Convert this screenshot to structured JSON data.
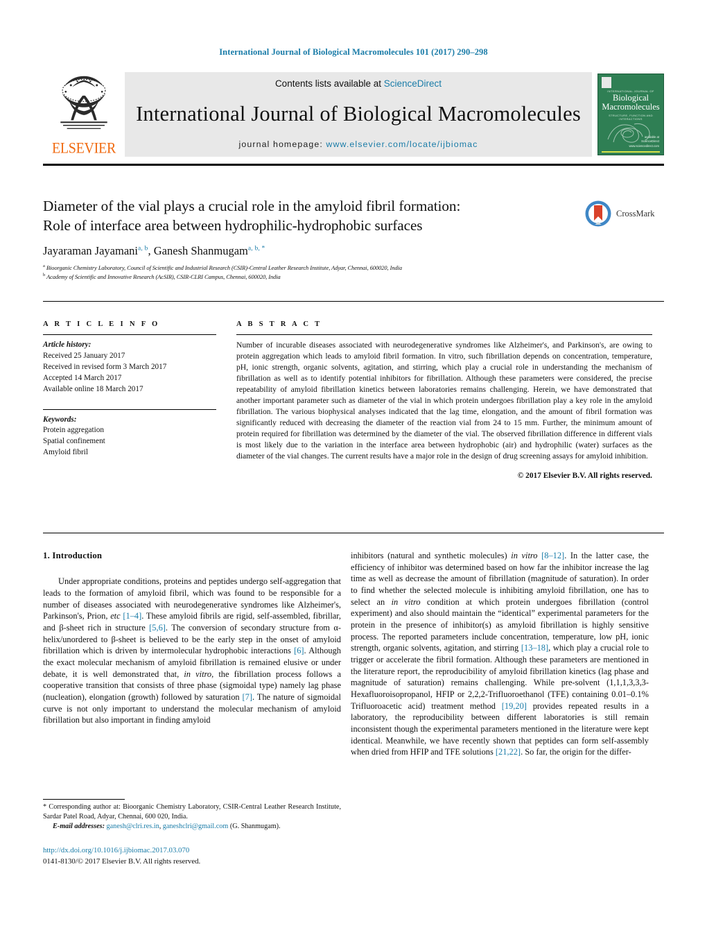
{
  "running_head": "International Journal of Biological Macromolecules 101 (2017) 290–298",
  "masthead": {
    "publisher": "ELSEVIER",
    "contents_prefix": "Contents lists available at ",
    "contents_link": "ScienceDirect",
    "journal_title": "International Journal of Biological Macromolecules",
    "homepage_prefix": "journal homepage: ",
    "homepage_url": "www.elsevier.com/locate/ijbiomac",
    "cover": {
      "kicker": "INTERNATIONAL JOURNAL OF",
      "title_line1": "Biological",
      "title_line2": "Macromolecules",
      "subtitle": "STRUCTURE, FUNCTION AND INTERACTIONS",
      "sd_line1": "available at",
      "sd_line2": "ScienceDirect",
      "sd_line3": "www.sciencedirect.com"
    }
  },
  "article": {
    "title_line1": "Diameter of the vial plays a crucial role in the amyloid fibril formation:",
    "title_line2": "Role of interface area between hydrophilic-hydrophobic surfaces",
    "crossmark_label": "CrossMark",
    "authors": [
      {
        "name": "Jayaraman Jayamani",
        "marks": "a, b"
      },
      {
        "name": "Ganesh Shanmugam",
        "marks": "a, b, *"
      }
    ],
    "authors_separator": ", ",
    "affiliations": [
      {
        "mark": "a",
        "text": "Bioorganic Chemistry Laboratory, Council of Scientific and Industrial Research (CSIR)-Central Leather Research Institute, Adyar, Chennai, 600020, India"
      },
      {
        "mark": "b",
        "text": "Academy of Scientific and Innovative Research (AcSIR), CSIR-CLRI Campus, Chennai, 600020, India"
      }
    ]
  },
  "article_info": {
    "heading": "A R T I C L E   I N F O",
    "history_label": "Article history:",
    "history": [
      "Received 25 January 2017",
      "Received in revised form 3 March 2017",
      "Accepted 14 March 2017",
      "Available online 18 March 2017"
    ],
    "keywords_label": "Keywords:",
    "keywords": [
      "Protein aggregation",
      "Spatial confinement",
      "Amyloid fibril"
    ]
  },
  "abstract": {
    "heading": "A B S T R A C T",
    "body": "Number of incurable diseases associated with neurodegenerative syndromes like Alzheimer's, and Parkinson's, are owing to protein aggregation which leads to amyloid fibril formation. In vitro, such fibrillation depends on concentration, temperature, pH, ionic strength, organic solvents, agitation, and stirring, which play a crucial role in understanding the mechanism of fibrillation as well as to identify potential inhibitors for fibrillation. Although these parameters were considered, the precise repeatability of amyloid fibrillation kinetics between laboratories remains challenging. Herein, we have demonstrated that another important parameter such as diameter of the vial in which protein undergoes fibrillation play a key role in the amyloid fibrillation. The various biophysical analyses indicated that the lag time, elongation, and the amount of fibril formation was significantly reduced with decreasing the diameter of the reaction vial from 24 to 15 mm. Further, the minimum amount of protein required for fibrillation was determined by the diameter of the vial. The observed fibrillation difference in different vials is most likely due to the variation in the interface area between hydrophobic (air) and hydrophilic (water) surfaces as the diameter of the vial changes. The current results have a major role in the design of drug screening assays for amyloid inhibition.",
    "copyright": "© 2017 Elsevier B.V. All rights reserved."
  },
  "introduction": {
    "heading": "1.  Introduction",
    "left_segments": [
      {
        "t": "Under appropriate conditions, proteins and peptides undergo self-aggregation that leads to the formation of amyloid fibril, which was found to be responsible for a number of diseases associated with neurodegenerative syndromes like Alzheimer's, Parkinson's, Prion, ",
        "k": "plain"
      },
      {
        "t": "etc",
        "k": "italic"
      },
      {
        "t": " ",
        "k": "plain"
      },
      {
        "t": "[1–4]",
        "k": "ref"
      },
      {
        "t": ". These amyloid fibrils are rigid, self-assembled, fibrillar, and β-sheet rich in structure ",
        "k": "plain"
      },
      {
        "t": "[5,6]",
        "k": "ref"
      },
      {
        "t": ". The conversion of secondary structure from α-helix/unordered to β-sheet is believed to be the early step in the onset of amyloid fibrillation which is driven by intermolecular hydrophobic interactions ",
        "k": "plain"
      },
      {
        "t": "[6]",
        "k": "ref"
      },
      {
        "t": ". Although the exact molecular mechanism of amyloid fibrillation is remained elusive or under debate, it is well demonstrated that, ",
        "k": "plain"
      },
      {
        "t": "in vitro",
        "k": "italic"
      },
      {
        "t": ", the fibrillation process follows a cooperative transition that consists of three phase (sigmoidal type) namely lag phase (nucleation), elongation (growth) followed by saturation ",
        "k": "plain"
      },
      {
        "t": "[7]",
        "k": "ref"
      },
      {
        "t": ". The nature of sigmoidal curve is not only important to understand the molecular mechanism of amyloid fibrillation but also important in finding amyloid",
        "k": "plain"
      }
    ],
    "right_segments": [
      {
        "t": "inhibitors (natural and synthetic molecules) ",
        "k": "plain"
      },
      {
        "t": "in vitro",
        "k": "italic"
      },
      {
        "t": " ",
        "k": "plain"
      },
      {
        "t": "[8–12]",
        "k": "ref"
      },
      {
        "t": ". In the latter case, the efficiency of inhibitor was determined based on how far the inhibitor increase the lag time as well as decrease the amount of fibrillation (magnitude of saturation). In order to find whether the selected molecule is inhibiting amyloid fibrillation, one has to select an ",
        "k": "plain"
      },
      {
        "t": "in vitro",
        "k": "italic"
      },
      {
        "t": " condition at which protein undergoes fibrillation (control experiment) and also should maintain the “identical” experimental parameters for the protein in the presence of inhibitor(s) as amyloid fibrillation is highly sensitive process. The reported parameters include concentration, temperature, low pH, ionic strength, organic solvents, agitation, and stirring ",
        "k": "plain"
      },
      {
        "t": "[13–18]",
        "k": "ref"
      },
      {
        "t": ", which play a crucial role to trigger or accelerate the fibril formation. Although these parameters are mentioned in the literature report, the reproducibility of amyloid fibrillation kinetics (lag phase and magnitude of saturation) remains challenging. While pre-solvent (1,1,1,3,3,3-Hexafluoroisopropanol, HFIP or 2,2,2-Trifluoroethanol (TFE) containing 0.01–0.1% Trifluoroacetic acid) treatment method ",
        "k": "plain"
      },
      {
        "t": "[19,20]",
        "k": "ref"
      },
      {
        "t": " provides repeated results in a laboratory, the reproducibility between different laboratories is still remain inconsistent though the experimental parameters mentioned in the literature were kept identical. Meanwhile, we have recently shown that peptides can form self-assembly when dried from HFIP and TFE solutions ",
        "k": "plain"
      },
      {
        "t": "[21,22]",
        "k": "ref"
      },
      {
        "t": ". So far, the origin for the differ-",
        "k": "plain"
      }
    ]
  },
  "footnote": {
    "marker": "*",
    "corresponding": " Corresponding author at: Bioorganic Chemistry Laboratory, CSIR-Central Leather Research Institute, Sardar Patel Road, Adyar, Chennai, 600 020, India.",
    "email_label": "E-mail addresses:",
    "email1": "ganesh@clri.res.in",
    "email_sep": ", ",
    "email2": "ganeshclri@gmail.com",
    "email_attrib": " (G. Shanmugam)."
  },
  "doi_block": {
    "doi": "http://dx.doi.org/10.1016/j.ijbiomac.2017.03.070",
    "issn_line": "0141-8130/© 2017 Elsevier B.V. All rights reserved."
  },
  "colors": {
    "link": "#1a7ca8",
    "elsevier_orange": "#f06a10",
    "cover_green": "#2f7f54",
    "crossmark_blue": "#3f87c6",
    "crossmark_red": "#d9422b"
  }
}
